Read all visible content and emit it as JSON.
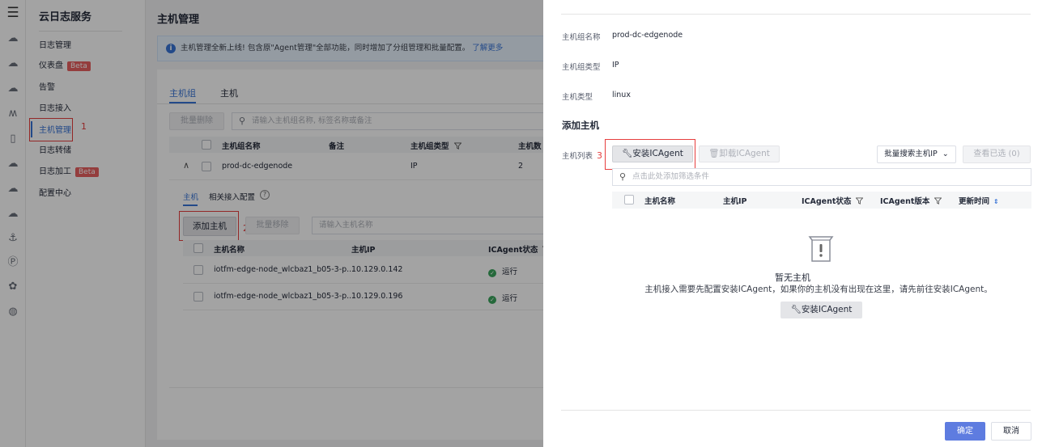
{
  "iconbar": {
    "icons": [
      "menu-icon",
      "cloud-icon",
      "cloud-icon",
      "cloud-icon",
      "pillars-icon",
      "document-icon",
      "cloud-icon",
      "cloud-icon",
      "cloud-icon",
      "anchor-icon",
      "parking-icon",
      "flower-icon",
      "globe-icon"
    ]
  },
  "nav": {
    "title": "云日志服务",
    "items": [
      {
        "label": "日志管理",
        "badge": ""
      },
      {
        "label": "仪表盘",
        "badge": "Beta"
      },
      {
        "label": "告警",
        "badge": ""
      },
      {
        "label": "日志接入",
        "badge": ""
      },
      {
        "label": "主机管理",
        "badge": ""
      },
      {
        "label": "日志转储",
        "badge": ""
      },
      {
        "label": "日志加工",
        "badge": "Beta"
      },
      {
        "label": "配置中心",
        "badge": ""
      }
    ],
    "marker": "1"
  },
  "main": {
    "title": "主机管理",
    "notice": "主机管理全新上线! 包含原\"Agent管理\"全部功能，同时增加了分组管理和批量配置。",
    "notice_link": "了解更多",
    "tabs": [
      "主机组",
      "主机"
    ],
    "batch_delete": "批量删除",
    "group_search_placeholder": "请输入主机组名称, 标签名称或备注",
    "group_table": {
      "headers": [
        "主机组名称",
        "备注",
        "主机组类型",
        "主机数"
      ],
      "row": {
        "name": "prod-dc-edgenode",
        "note": "",
        "type": "IP",
        "count": "2"
      }
    },
    "subtabs": [
      "主机",
      "相关接入配置"
    ],
    "help": "?",
    "add_host": "添加主机",
    "marker2": "2",
    "batch_remove": "批量移除",
    "host_search_placeholder": "请输入主机名称",
    "host_table": {
      "headers": [
        "主机名称",
        "主机IP",
        "ICAgent状态"
      ],
      "rows": [
        {
          "name": "iotfm-edge-node_wlcbaz1_b05-3-p...",
          "ip": "10.129.0.142",
          "status": "运行"
        },
        {
          "name": "iotfm-edge-node_wlcbaz1_b05-3-p...",
          "ip": "10.129.0.196",
          "status": "运行"
        }
      ]
    }
  },
  "drawer": {
    "fields": [
      {
        "label": "主机组名称",
        "value": "prod-dc-edgenode"
      },
      {
        "label": "主机组类型",
        "value": "IP"
      },
      {
        "label": "主机类型",
        "value": "linux"
      }
    ],
    "section_title": "添加主机",
    "host_list_label": "主机列表",
    "marker3": "3",
    "install_btn": "安装ICAgent",
    "uninstall_btn": "卸载ICAgent",
    "batch_search": "批量搜索主机IP",
    "view_selected": "查看已选 (0)",
    "filter_placeholder": "点击此处添加筛选条件",
    "table_headers": [
      "主机名称",
      "主机IP",
      "ICAgent状态",
      "ICAgent版本",
      "更新时间"
    ],
    "empty_title": "暂无主机",
    "empty_desc": "主机接入需要先配置安装ICAgent，如果你的主机没有出现在这里，请先前往安装ICAgent。",
    "empty_btn": "安装ICAgent",
    "confirm": "确定",
    "cancel": "取消"
  },
  "colors": {
    "primary": "#5e7ce0",
    "marker_red": "#e63e3e",
    "badge": "#e86060"
  }
}
